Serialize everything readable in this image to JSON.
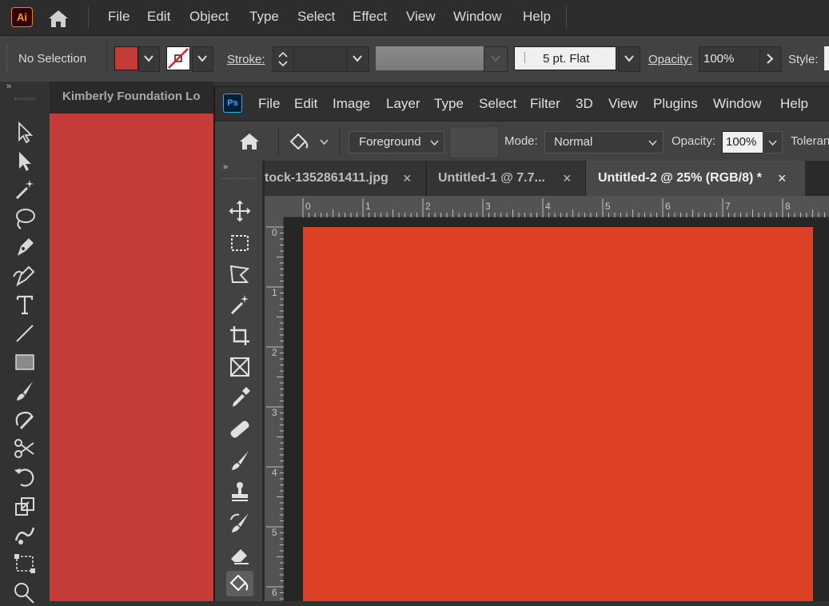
{
  "illustrator": {
    "logo": "Ai",
    "menu": [
      "File",
      "Edit",
      "Object",
      "Type",
      "Select",
      "Effect",
      "View",
      "Window",
      "Help"
    ],
    "control": {
      "selection_status": "No Selection",
      "fill_color": "#c53b38",
      "stroke_label": "Stroke:",
      "brush_label": "5 pt. Flat",
      "opacity_label": "Opacity:",
      "opacity_value": "100%",
      "style_label": "Style:"
    },
    "document_tab": "Kimberly Foundation Lo",
    "canvas_color": "#c53b38",
    "tools": [
      "selection-icon",
      "direct-selection-icon",
      "magic-wand-icon",
      "lasso-icon",
      "pen-icon",
      "curvature-icon",
      "type-icon",
      "line-segment-icon",
      "rectangle-icon",
      "paintbrush-icon",
      "shaper-icon",
      "scissors-icon",
      "rotate-icon",
      "scale-icon",
      "warp-icon",
      "free-transform-icon",
      "shape-builder-icon"
    ]
  },
  "photoshop": {
    "logo": "Ps",
    "menu": [
      "File",
      "Edit",
      "Image",
      "Layer",
      "Type",
      "Select",
      "Filter",
      "3D",
      "View",
      "Plugins",
      "Window",
      "Help"
    ],
    "options": {
      "fill_source": "Foreground",
      "mode_label": "Mode:",
      "mode_value": "Normal",
      "opacity_label": "Opacity:",
      "opacity_value": "100%",
      "tolerance_label": "Toleran"
    },
    "tabs": [
      {
        "label": "tock-1352861411.jpg",
        "close": "×",
        "active": false
      },
      {
        "label": "Untitled-1 @ 7.7...",
        "close": "×",
        "active": false
      },
      {
        "label": "Untitled-2 @ 25% (RGB/8) *",
        "close": "×",
        "active": true
      }
    ],
    "ruler_h": [
      "0",
      "1",
      "2",
      "3",
      "4",
      "5",
      "6",
      "7",
      "8"
    ],
    "ruler_v": [
      "0",
      "1",
      "2",
      "3",
      "4",
      "5",
      "6"
    ],
    "canvas_color": "#dc4025",
    "tools": [
      "move-icon",
      "marquee-icon",
      "lasso-icon",
      "magic-wand-icon",
      "crop-icon",
      "frame-icon",
      "eyedropper-icon",
      "healing-brush-icon",
      "brush-icon",
      "clone-stamp-icon",
      "history-brush-icon",
      "eraser-icon",
      "paint-bucket-icon"
    ]
  }
}
